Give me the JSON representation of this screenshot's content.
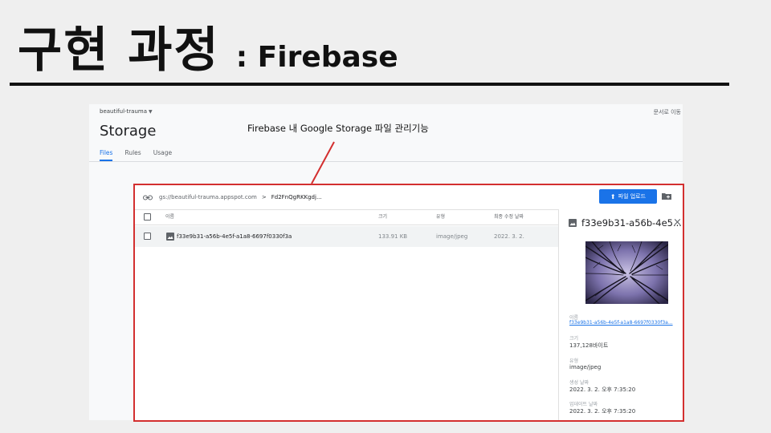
{
  "slide": {
    "title_korean": "구현 과정",
    "title_suffix": ": Firebase"
  },
  "annotation": {
    "text": "Firebase 내 Google Storage 파일 관리기능",
    "color": "#d32f2f"
  },
  "console": {
    "project_name": "beautiful-trauma",
    "docs_link": "문서로 이동",
    "page_title": "Storage",
    "tabs": [
      {
        "label": "Files",
        "active": true
      },
      {
        "label": "Rules",
        "active": false
      },
      {
        "label": "Usage",
        "active": false
      }
    ],
    "path": {
      "bucket": "gs://beautiful-trauma.appspot.com",
      "separator": ">",
      "folder": "Fd2FnQgRKKgdj..."
    },
    "upload_button": "파일 업로드",
    "columns": {
      "name": "이름",
      "size": "크기",
      "type": "유형",
      "modified": "최종 수정 날짜"
    },
    "files": [
      {
        "name": "f33e9b31-a56b-4e5f-a1a8-6697f0330f3a",
        "size": "133.91 KB",
        "type": "image/jpeg",
        "modified": "2022. 3. 2."
      }
    ],
    "detail": {
      "title": "f33e9b31-a56b-4e5...",
      "name_label": "이름",
      "name_value": "f33e9b31-a56b-4e5f-a1a8-6697f0330f3a...",
      "size_label": "크기",
      "size_value": "137,128바이트",
      "type_label": "유형",
      "type_value": "image/jpeg",
      "created_label": "생성 날짜",
      "created_value": "2022. 3. 2. 오후 7:35:20",
      "updated_label": "업데이트 날짜",
      "updated_value": "2022. 3. 2. 오후 7:35:20"
    },
    "accent_color": "#1a73e8"
  }
}
